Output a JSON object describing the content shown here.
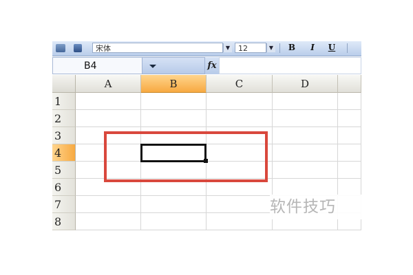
{
  "toolbar": {
    "font_name": "宋体",
    "font_size": "12",
    "bold_label": "B",
    "italic_label": "I",
    "underline_label": "U"
  },
  "formula_bar": {
    "name_box": "B4",
    "fx_label": "fx",
    "formula_value": ""
  },
  "grid": {
    "columns": [
      "A",
      "B",
      "C",
      "D"
    ],
    "rows": [
      "1",
      "2",
      "3",
      "4",
      "5",
      "6",
      "7",
      "8"
    ],
    "active_column": "B",
    "active_row": "4",
    "active_cell": "B4"
  },
  "annotation": {
    "highlight_color": "#d9483d"
  },
  "watermark": {
    "text": "软件技巧"
  },
  "colors": {
    "accent_orange": "#f7a941",
    "toolbar_blue": "#b9cdea"
  }
}
